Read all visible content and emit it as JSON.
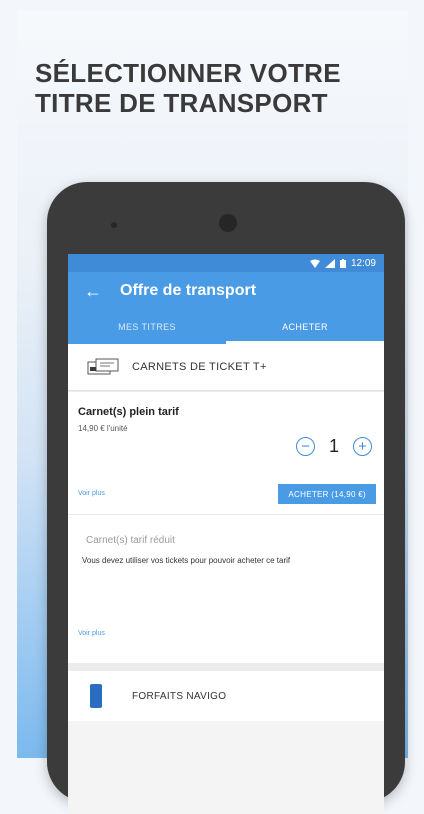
{
  "promo": {
    "line1": "SÉLECTIONNER VOTRE",
    "line2": "TITRE DE TRANSPORT"
  },
  "status": {
    "time": "12:09"
  },
  "appbar": {
    "title": "Offre de transport"
  },
  "tabs": [
    {
      "label": "MES TITRES",
      "active": false
    },
    {
      "label": "ACHETER",
      "active": true
    }
  ],
  "sections": {
    "tickets": {
      "title": "CARNETS DE TICKET T+"
    },
    "navigo": {
      "title": "FORFAITS NAVIGO"
    }
  },
  "product_full": {
    "name": "Carnet(s) plein tarif",
    "price": "14,90 € l'unité",
    "quantity": "1",
    "see_more": "Voir plus",
    "buy_label": "ACHETER (14,90 €)"
  },
  "product_reduced": {
    "name": "Carnet(s) tarif réduit",
    "message": "Vous devez utiliser vos tickets pour pouvoir acheter ce tarif",
    "see_more": "Voir plus"
  },
  "colors": {
    "primary": "#4a9be6",
    "status_bar": "#3f8bd7",
    "phone_body": "#3b3b3b"
  }
}
